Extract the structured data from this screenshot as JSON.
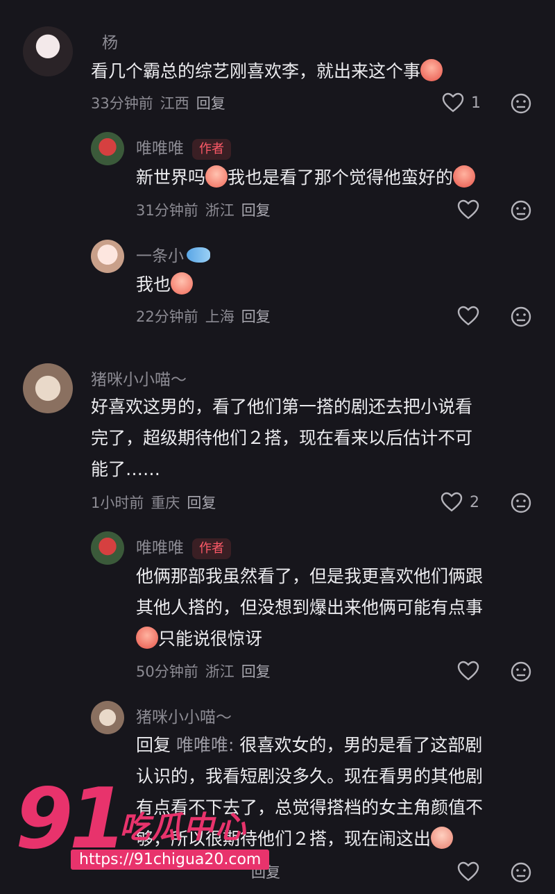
{
  "comments": [
    {
      "username": "杨",
      "text_before": "看几个霸总的综艺刚喜欢李，就出来这个事",
      "text_after": "",
      "time": "33分钟前",
      "location": "江西",
      "reply_label": "回复",
      "likes": "1",
      "replies": [
        {
          "username": "唯唯唯",
          "badge": "作者",
          "text_before": "新世界吗",
          "text_mid": "我也是看了那个觉得他蛮好的",
          "time": "31分钟前",
          "location": "浙江",
          "reply_label": "回复",
          "likes": ""
        },
        {
          "username": "一条小",
          "text_before": "我也",
          "time": "22分钟前",
          "location": "上海",
          "reply_label": "回复",
          "likes": ""
        }
      ]
    },
    {
      "username": "猪咪小小喵～",
      "text_lines": [
        "好喜欢这男的，看了他们第一搭的剧还去把小说看",
        "完了，超级期待他们２搭，现在看来以后估计不可",
        "能了……"
      ],
      "time": "1小时前",
      "location": "重庆",
      "reply_label": "回复",
      "likes": "2",
      "replies": [
        {
          "username": "唯唯唯",
          "badge": "作者",
          "text_lines": [
            "他俩那部我虽然看了，但是我更喜欢他们俩跟",
            "其他人搭的，但没想到爆出来他俩可能有点事"
          ],
          "text_last": "只能说很惊讶",
          "time": "50分钟前",
          "location": "浙江",
          "reply_label": "回复",
          "likes": ""
        },
        {
          "username": "猪咪小小喵～",
          "reply_prefix": "回复",
          "mention": "唯唯唯:",
          "text_first": "很喜欢女的，男的是看了这部剧",
          "text_lines": [
            "认识的，我看短剧没多久。现在看男的其他剧",
            "有点看不下去了，总觉得搭档的女主角颜值不"
          ],
          "text_last": "够，所以很期待他们２搭，现在闹这出",
          "reply_label": "回复",
          "likes": ""
        }
      ]
    }
  ],
  "watermark": {
    "big": "91",
    "cn": "吃瓜中心",
    "url": "https://91chigua20.com"
  },
  "colors": {
    "background": "#17161c",
    "author_badge": "#ff5a68",
    "watermark": "#e8336c"
  }
}
